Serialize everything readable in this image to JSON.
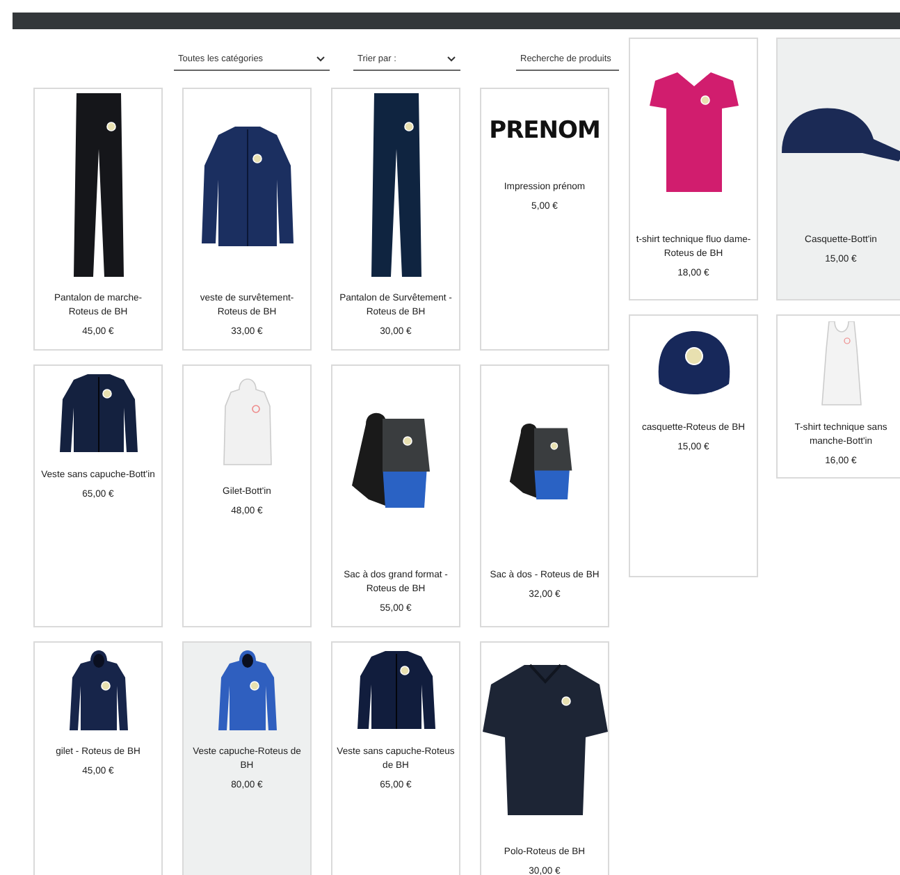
{
  "filters": {
    "category": "Toutes les catégories",
    "sort": "Trier par :",
    "search_placeholder": "Recherche de produits"
  },
  "columns": [
    {
      "products": [
        {
          "name": "Pantalon de marche- Roteus de BH",
          "price": "45,00 €",
          "kind": "pants",
          "color": "#15161a",
          "highlighted": false
        },
        {
          "name": "Veste sans capuche-Bott'in",
          "price": "65,00 €",
          "kind": "softshell",
          "color": "#14213f",
          "highlighted": false
        },
        {
          "name": "gilet - Roteus de BH",
          "price": "45,00 €",
          "kind": "hooded",
          "color": "#17254a",
          "highlighted": false
        }
      ]
    },
    {
      "products": [
        {
          "name": "veste de survêtement-Roteus de BH",
          "price": "33,00 €",
          "kind": "track-jacket",
          "color": "#1b2f60",
          "highlighted": false
        },
        {
          "name": "Gilet-Bott'in",
          "price": "48,00 €",
          "kind": "hoodie",
          "color": "#f1f1f1",
          "highlighted": false
        },
        {
          "name": "Veste capuche-Roteus de BH",
          "price": "80,00 €",
          "kind": "hooded",
          "color": "#2f5fbf",
          "highlighted": true
        }
      ]
    },
    {
      "products": [
        {
          "name": "Pantalon de Survêtement - Roteus de BH",
          "price": "30,00 €",
          "kind": "pants",
          "color": "#0f2440",
          "highlighted": false
        },
        {
          "name": "Sac à dos grand format - Roteus de BH",
          "price": "55,00 €",
          "kind": "backpack",
          "color": "#2a62c4",
          "highlighted": false
        },
        {
          "name": "Veste sans capuche-Roteus de BH",
          "price": "65,00 €",
          "kind": "softshell",
          "color": "#111d3d",
          "highlighted": false
        }
      ]
    },
    {
      "products": [
        {
          "name": "Impression prénom",
          "price": "5,00 €",
          "kind": "lettering",
          "image_text": "PRENOM",
          "color": "#111111",
          "highlighted": false
        },
        {
          "name": "Sac à dos - Roteus de BH",
          "price": "32,00 €",
          "kind": "backpack-small",
          "color": "#2a62c4",
          "highlighted": false
        },
        {
          "name": "Polo-Roteus de BH",
          "price": "30,00 €",
          "kind": "polo",
          "color": "#1d2535",
          "highlighted": false
        }
      ]
    },
    {
      "products": [
        {
          "name": "t-shirt technique fluo dame-Roteus de BH",
          "price": "18,00 €",
          "kind": "tshirt",
          "color": "#d11d6e",
          "highlighted": false
        },
        {
          "name": "casquette-Roteus de BH",
          "price": "15,00 €",
          "kind": "cap-front",
          "color": "#17285a",
          "highlighted": false
        }
      ]
    },
    {
      "products": [
        {
          "name": "Casquette-Bott'in",
          "price": "15,00 €",
          "kind": "cap-side",
          "color": "#1b2a55",
          "highlighted": true
        },
        {
          "name": "T-shirt technique sans manche-Bott'in",
          "price": "16,00 €",
          "kind": "tank",
          "color": "#f3f3f3",
          "highlighted": false
        }
      ]
    }
  ]
}
